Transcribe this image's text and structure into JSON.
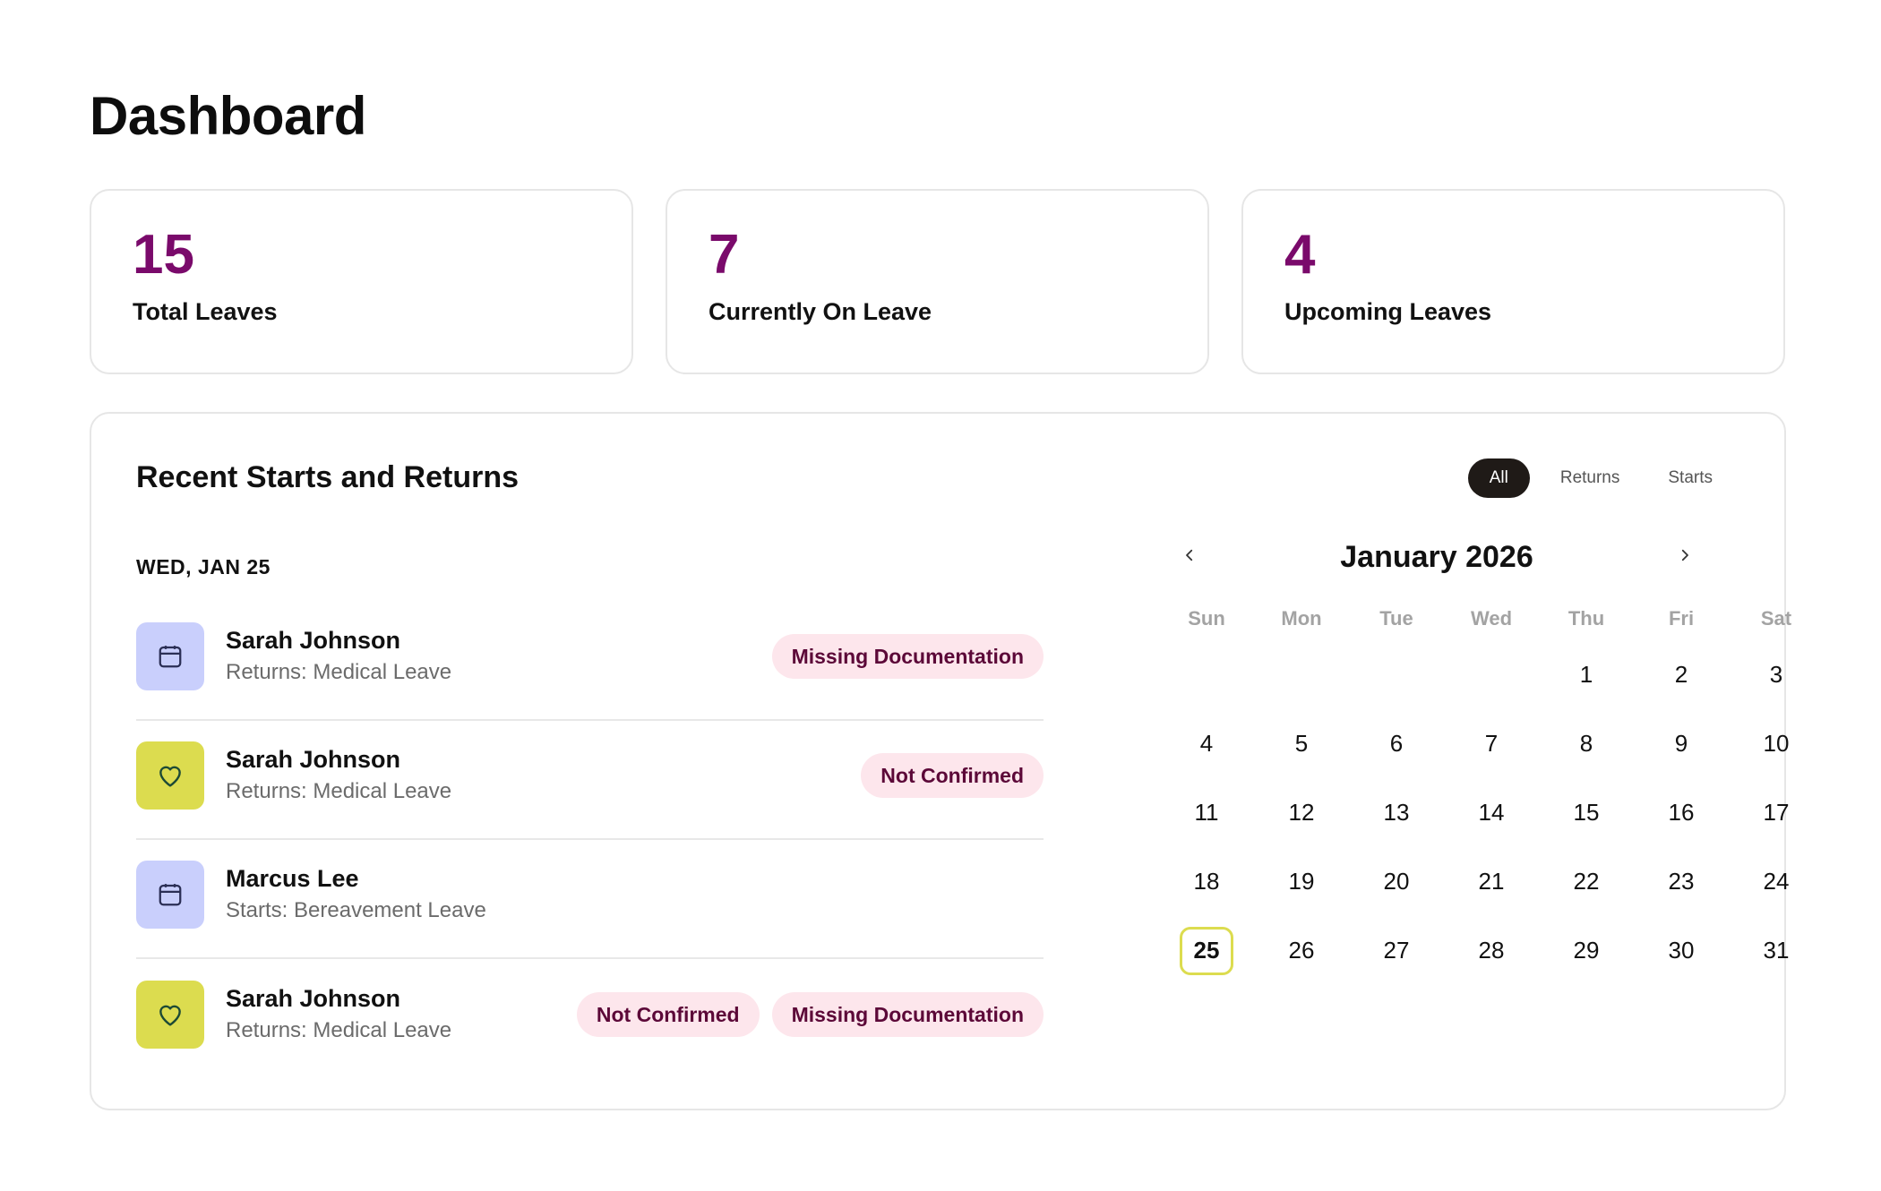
{
  "page": {
    "title": "Dashboard"
  },
  "stats": [
    {
      "value": "15",
      "label": "Total Leaves"
    },
    {
      "value": "7",
      "label": "Currently On Leave"
    },
    {
      "value": "4",
      "label": "Upcoming Leaves"
    }
  ],
  "panel": {
    "title": "Recent Starts and Returns",
    "filters": [
      "All",
      "Returns",
      "Starts"
    ],
    "active_filter": "All",
    "date_heading": "WED, JAN 25",
    "items": [
      {
        "name": "Sarah Johnson",
        "sub": "Returns: Medical Leave",
        "icon": "calendar-icon",
        "badges": [
          "Missing Documentation"
        ]
      },
      {
        "name": "Sarah Johnson",
        "sub": "Returns: Medical Leave",
        "icon": "heart-icon",
        "badges": [
          "Not Confirmed"
        ]
      },
      {
        "name": "Marcus Lee",
        "sub": "Starts: Bereavement Leave",
        "icon": "calendar-icon",
        "badges": []
      },
      {
        "name": "Sarah Johnson",
        "sub": "Returns: Medical Leave",
        "icon": "heart-icon",
        "badges": [
          "Not Confirmed",
          "Missing Documentation"
        ]
      }
    ]
  },
  "calendar": {
    "title": "January 2026",
    "weekdays": [
      "Sun",
      "Mon",
      "Tue",
      "Wed",
      "Thu",
      "Fri",
      "Sat"
    ],
    "leading_blanks": 4,
    "days": [
      "1",
      "2",
      "3",
      "4",
      "5",
      "6",
      "7",
      "8",
      "9",
      "10",
      "11",
      "12",
      "13",
      "14",
      "15",
      "16",
      "17",
      "18",
      "19",
      "20",
      "21",
      "22",
      "23",
      "24",
      "25",
      "26",
      "27",
      "28",
      "29",
      "30",
      "31"
    ],
    "selected_day": "25"
  },
  "colors": {
    "stat_value": "#7a0a6b",
    "badge_bg": "#fde6ec",
    "badge_text": "#5c0838",
    "icon_blue": "#c9cffc",
    "icon_yellow": "#dcdc4f",
    "active_pill": "#1f1a17"
  }
}
